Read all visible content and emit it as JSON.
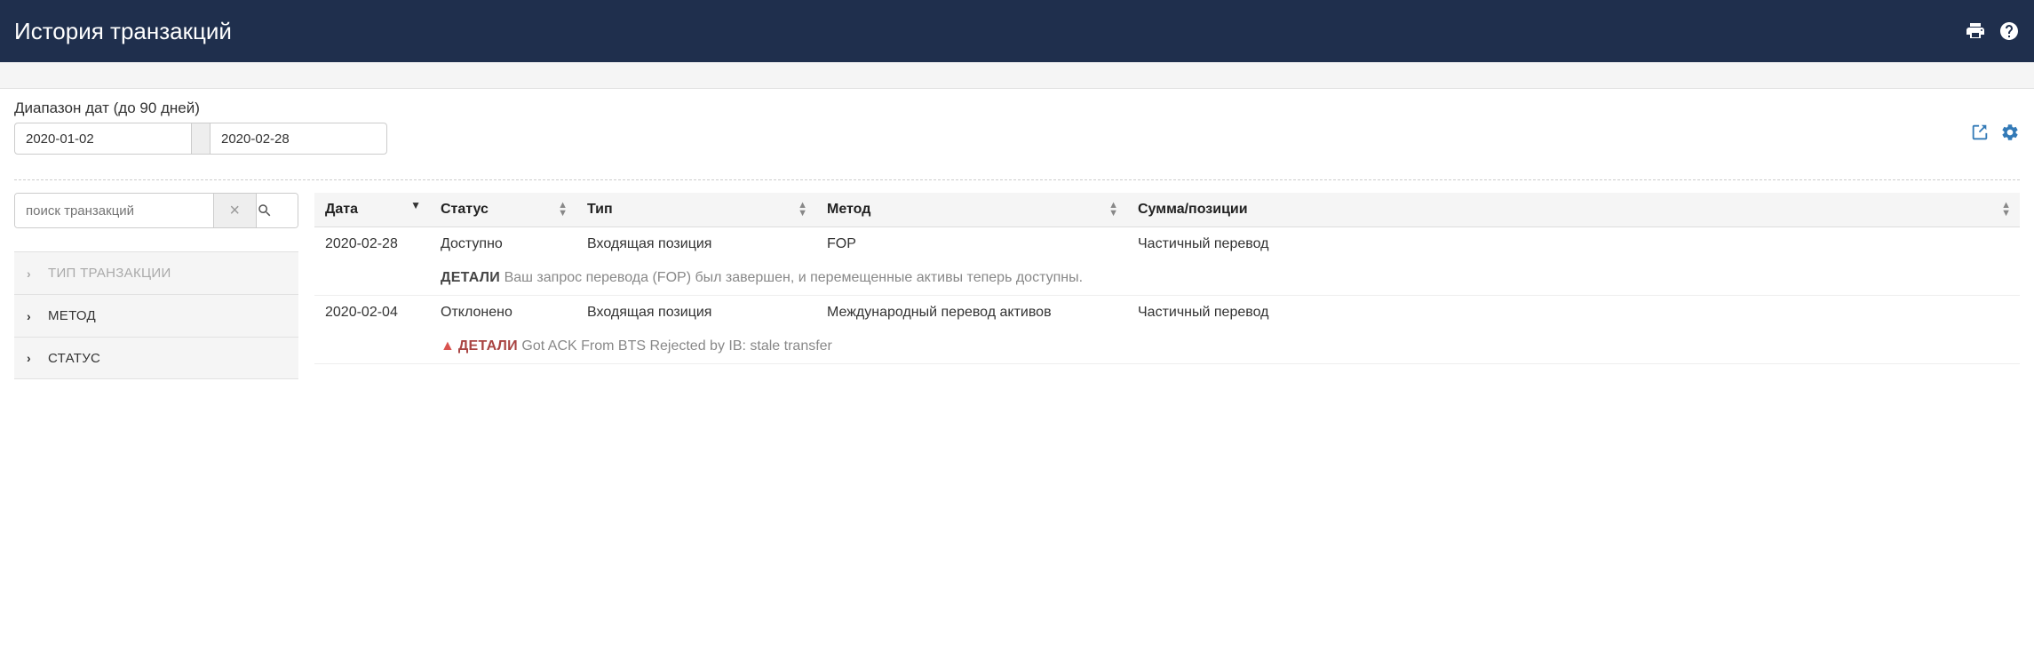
{
  "header": {
    "title": "История транзакций"
  },
  "dateRange": {
    "label": "Диапазон дат (до 90 дней)",
    "from": "2020-01-02",
    "to": "2020-02-28"
  },
  "search": {
    "placeholder": "поиск транзакций"
  },
  "filters": {
    "items": [
      {
        "label": "ТИП ТРАНЗАКЦИИ",
        "disabled": true
      },
      {
        "label": "МЕТОД",
        "disabled": false
      },
      {
        "label": "СТАТУС",
        "disabled": false
      }
    ]
  },
  "table": {
    "headers": {
      "date": "Дата",
      "status": "Статус",
      "type": "Тип",
      "method": "Метод",
      "amount": "Сумма/позиции"
    },
    "rows": [
      {
        "date": "2020-02-28",
        "status": "Доступно",
        "type": "Входящая позиция",
        "method": "FOP",
        "amount": "Частичный перевод",
        "detailsLabel": "ДЕТАЛИ",
        "detailsText": "Ваш запрос перевода (FOP) был завершен, и перемещенные активы теперь доступны.",
        "warn": false
      },
      {
        "date": "2020-02-04",
        "status": "Отклонено",
        "type": "Входящая позиция",
        "method": "Международный перевод активов",
        "amount": "Частичный перевод",
        "detailsLabel": "ДЕТАЛИ",
        "detailsText": "Got ACK From BTS Rejected by IB: stale transfer",
        "warn": true
      }
    ]
  }
}
